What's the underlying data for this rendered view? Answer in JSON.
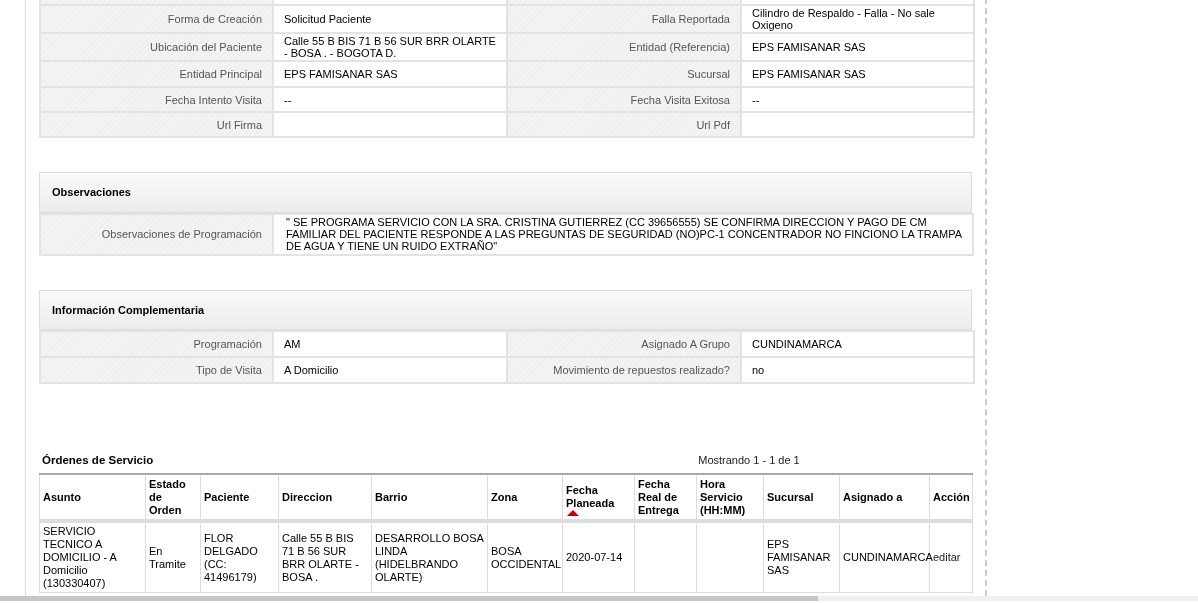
{
  "details": {
    "rows": [
      {
        "cells": [
          {
            "label": "Forma de Creación",
            "value": "Solicitud Paciente"
          },
          {
            "label": "Falla Reportada",
            "value": "Cilindro de Respaldo - Falla - No sale Oxigeno"
          }
        ]
      },
      {
        "cells": [
          {
            "label": "Ubicación del Paciente",
            "value": "Calle 55 B BIS 71 B 56 SUR BRR OLARTE - BOSA . - BOGOTA D."
          },
          {
            "label": "Entidad (Referencia)",
            "value": "EPS FAMISANAR SAS"
          }
        ]
      },
      {
        "cells": [
          {
            "label": "Entidad Principal",
            "value": "EPS FAMISANAR SAS"
          },
          {
            "label": "Sucursal",
            "value": "EPS FAMISANAR SAS"
          }
        ]
      },
      {
        "cells": [
          {
            "label": "Fecha Intento Visita",
            "value": "--"
          },
          {
            "label": "Fecha Visita Exitosa",
            "value": "--"
          }
        ]
      },
      {
        "cells": [
          {
            "label": "Url Firma"
          },
          {
            "label": "Url Pdf"
          }
        ]
      }
    ]
  },
  "observaciones": {
    "title": "Observaciones",
    "rows": [
      {
        "label": "Observaciones de Programación",
        "value": "\" SE PROGRAMA SERVICIO CON LA SRA. CRISTINA GUTIERREZ (CC 39656555) SE CONFIRMA DIRECCION Y PAGO DE CM FAMILIAR DEL PACIENTE RESPONDE A LAS PREGUNTAS DE SEGURIDAD (NO)PC-1 CONCENTRADOR NO FINCIONO LA TRAMPA DE AGUA Y TIENE UN RUIDO EXTRAÑO\""
      }
    ]
  },
  "informacion": {
    "title": "Información Complementaria",
    "rows": [
      {
        "cells": [
          {
            "label": "Programación",
            "value": "AM"
          },
          {
            "label": "Asignado A Grupo",
            "value": "CUNDINAMARCA"
          }
        ]
      },
      {
        "cells": [
          {
            "label": "Tipo de Visita",
            "value": "A Domicilio"
          },
          {
            "label": "Movimiento de repuestos realizado?",
            "value": "no"
          }
        ]
      }
    ]
  },
  "orders": {
    "title": "Órdenes de Servicio",
    "pager": "Mostrando 1 - 1 de 1",
    "columns": [
      {
        "label": "Asunto",
        "sorted": false
      },
      {
        "label": "Estado de Orden",
        "sorted": false
      },
      {
        "label": "Paciente",
        "sorted": false
      },
      {
        "label": "Direccion",
        "sorted": false
      },
      {
        "label": "Barrio",
        "sorted": false
      },
      {
        "label": "Zona",
        "sorted": false
      },
      {
        "label": "Fecha Planeada",
        "sorted": true
      },
      {
        "label": "Fecha Real de Entrega",
        "sorted": false
      },
      {
        "label": "Hora Servicio (HH:MM)",
        "sorted": false
      },
      {
        "label": "Sucursal",
        "sorted": false
      },
      {
        "label": "Asignado a",
        "sorted": false
      },
      {
        "label": "Acción",
        "sorted": false
      }
    ],
    "rows": [
      {
        "cells": [
          {
            "kind": "text",
            "text": "SERVICIO TECNICO A DOMICILIO - A Domicilio (130330407)"
          },
          {
            "kind": "text",
            "text": "En Tramite"
          },
          {
            "kind": "text",
            "text": "FLOR DELGADO (CC: 41496179)"
          },
          {
            "kind": "text",
            "text": "Calle 55 B BIS 71 B 56 SUR BRR OLARTE - BOSA ."
          },
          {
            "kind": "text",
            "text": "DESARROLLO BOSA LINDA (HIDELBRANDO OLARTE)"
          },
          {
            "kind": "text",
            "text": "BOSA OCCIDENTAL"
          },
          {
            "kind": "text",
            "text": "2020-07-14"
          },
          null,
          null,
          {
            "kind": "text",
            "text": "EPS FAMISANAR SAS"
          },
          {
            "kind": "text",
            "text": "CUNDINAMARCA"
          },
          {
            "kind": "link",
            "text": "editar"
          }
        ]
      }
    ]
  }
}
